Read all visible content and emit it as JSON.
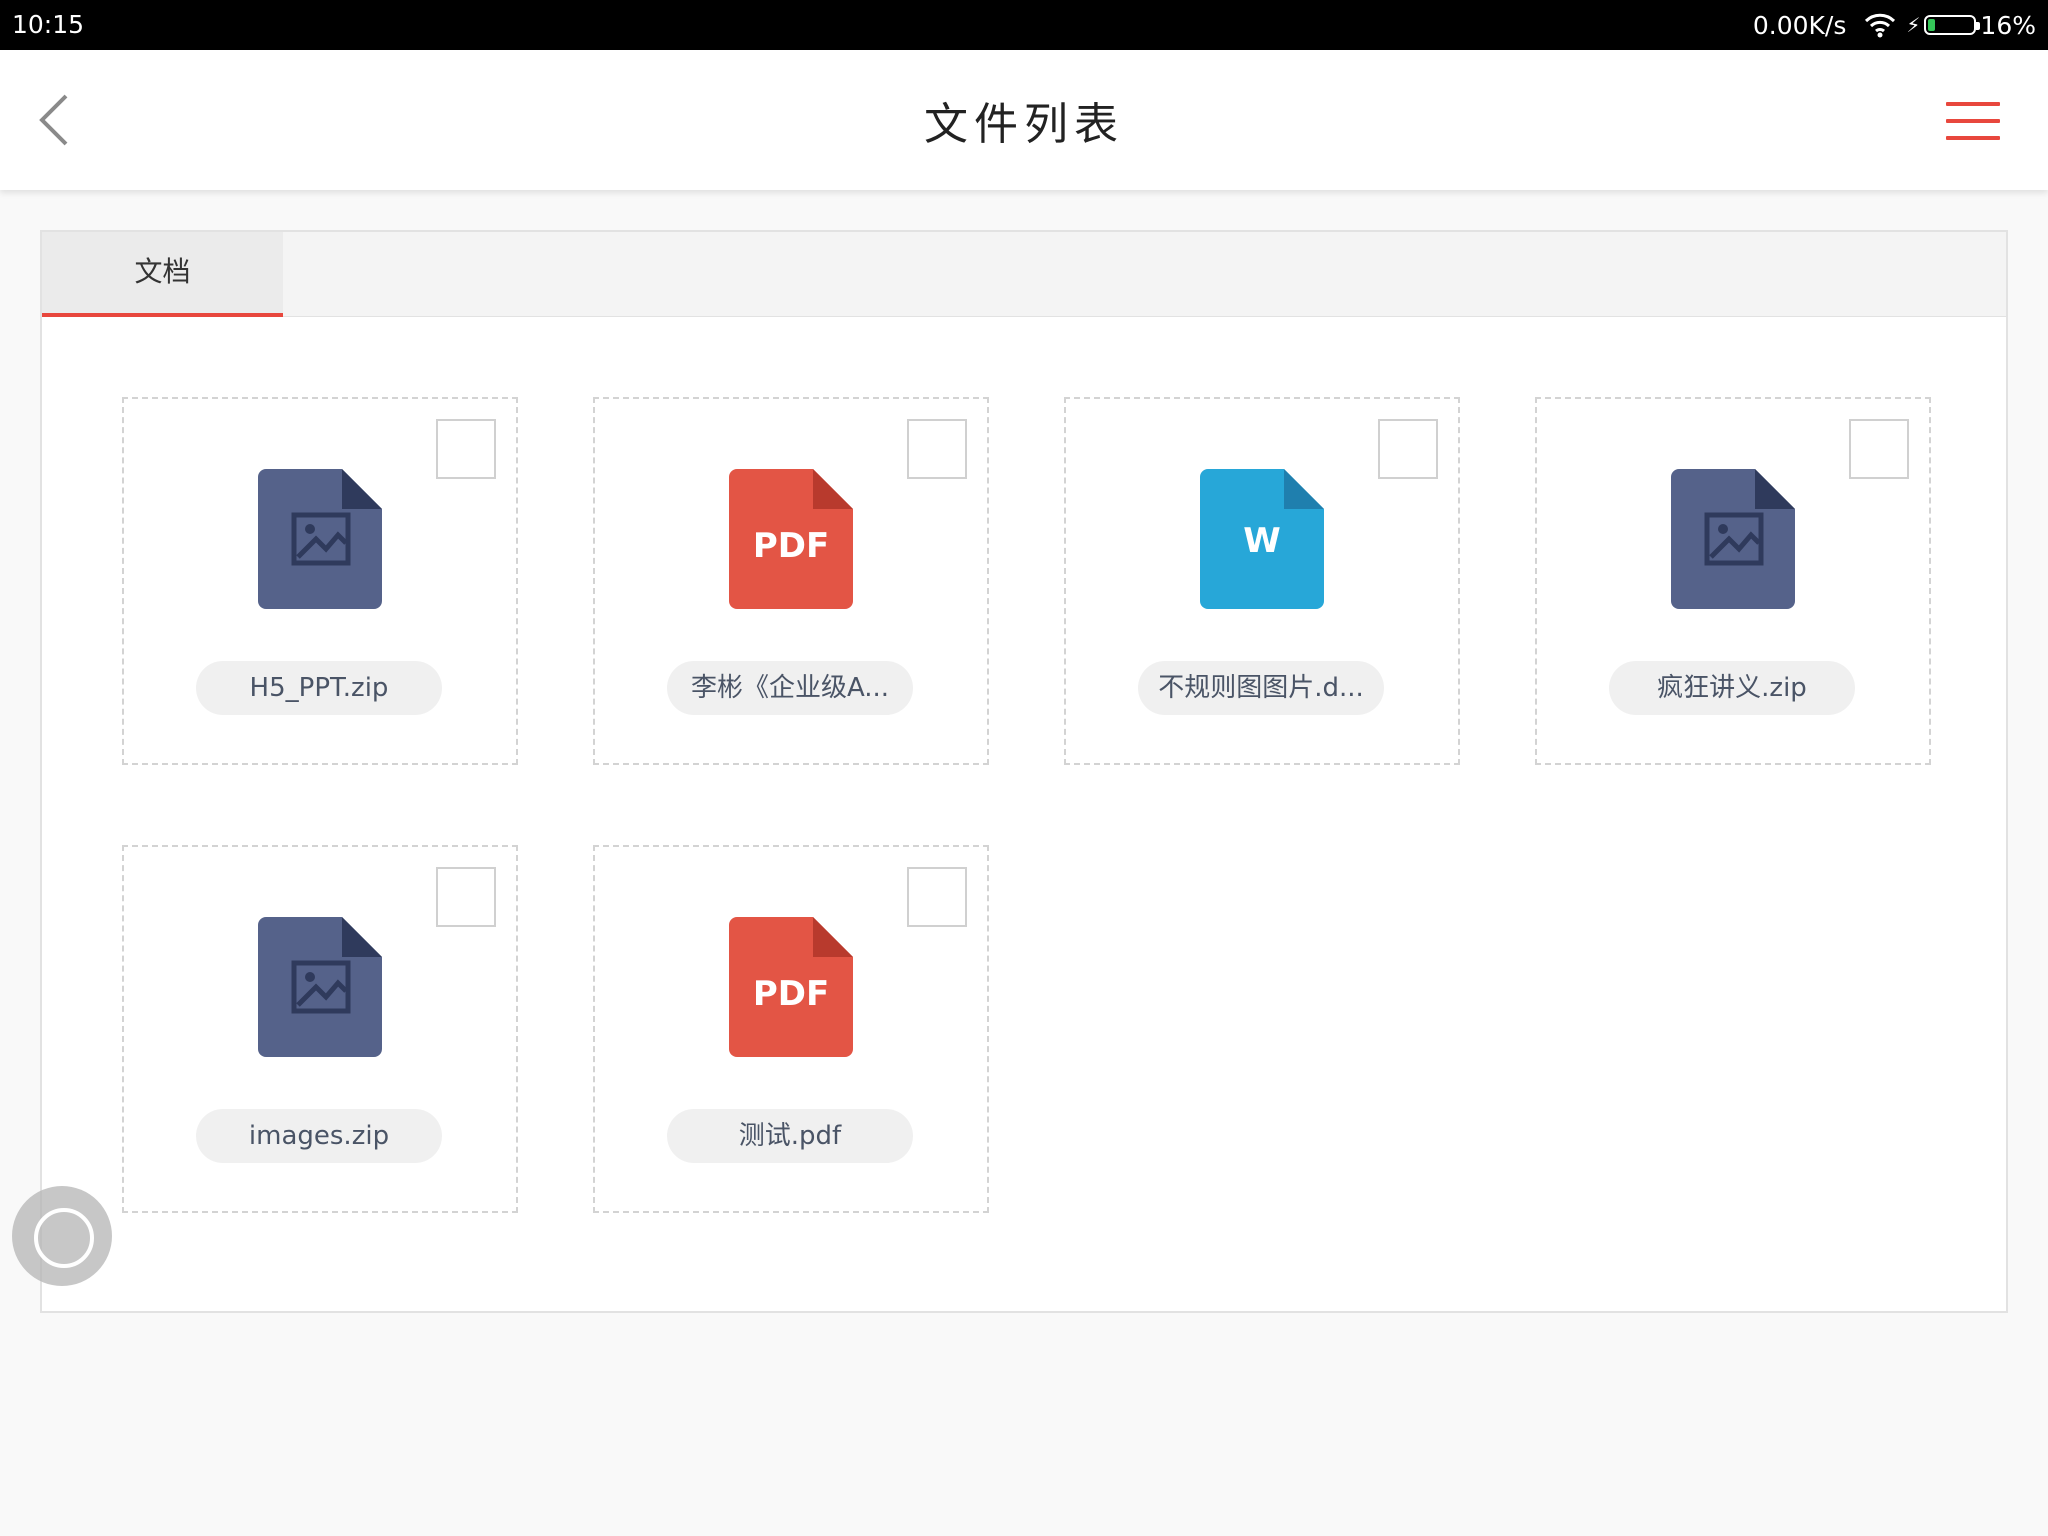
{
  "status_bar": {
    "time": "10:15",
    "net_speed": "0.00K/s",
    "battery_percent": "16%",
    "battery_level": 0.16
  },
  "header": {
    "title": "文件列表",
    "back_icon": "chevron-left-icon",
    "menu_icon": "hamburger-menu-icon",
    "accent_color": "#e8473d"
  },
  "tabs": [
    {
      "label": "文档",
      "active": true
    }
  ],
  "files": [
    {
      "name": "H5_PPT.zip",
      "type": "image",
      "icon": "image-file-icon",
      "checked": false
    },
    {
      "name": "李彬《企业级A...",
      "type": "pdf",
      "icon": "pdf-file-icon",
      "badge": "PDF",
      "checked": false
    },
    {
      "name": "不规则图图片.d...",
      "type": "word",
      "icon": "word-file-icon",
      "badge": "W",
      "checked": false
    },
    {
      "name": "疯狂讲义.zip",
      "type": "image",
      "icon": "image-file-icon",
      "checked": false
    },
    {
      "name": "images.zip",
      "type": "image",
      "icon": "image-file-icon",
      "checked": false
    },
    {
      "name": "测试.pdf",
      "type": "pdf",
      "icon": "pdf-file-icon",
      "badge": "PDF",
      "checked": false
    }
  ],
  "colors": {
    "image_file": "#55628a",
    "image_file_fold": "#2f3a5c",
    "pdf_file": "#e35545",
    "pdf_file_fold": "#b83a2d",
    "word_file": "#27a7d8",
    "word_file_fold": "#1f7fae"
  }
}
